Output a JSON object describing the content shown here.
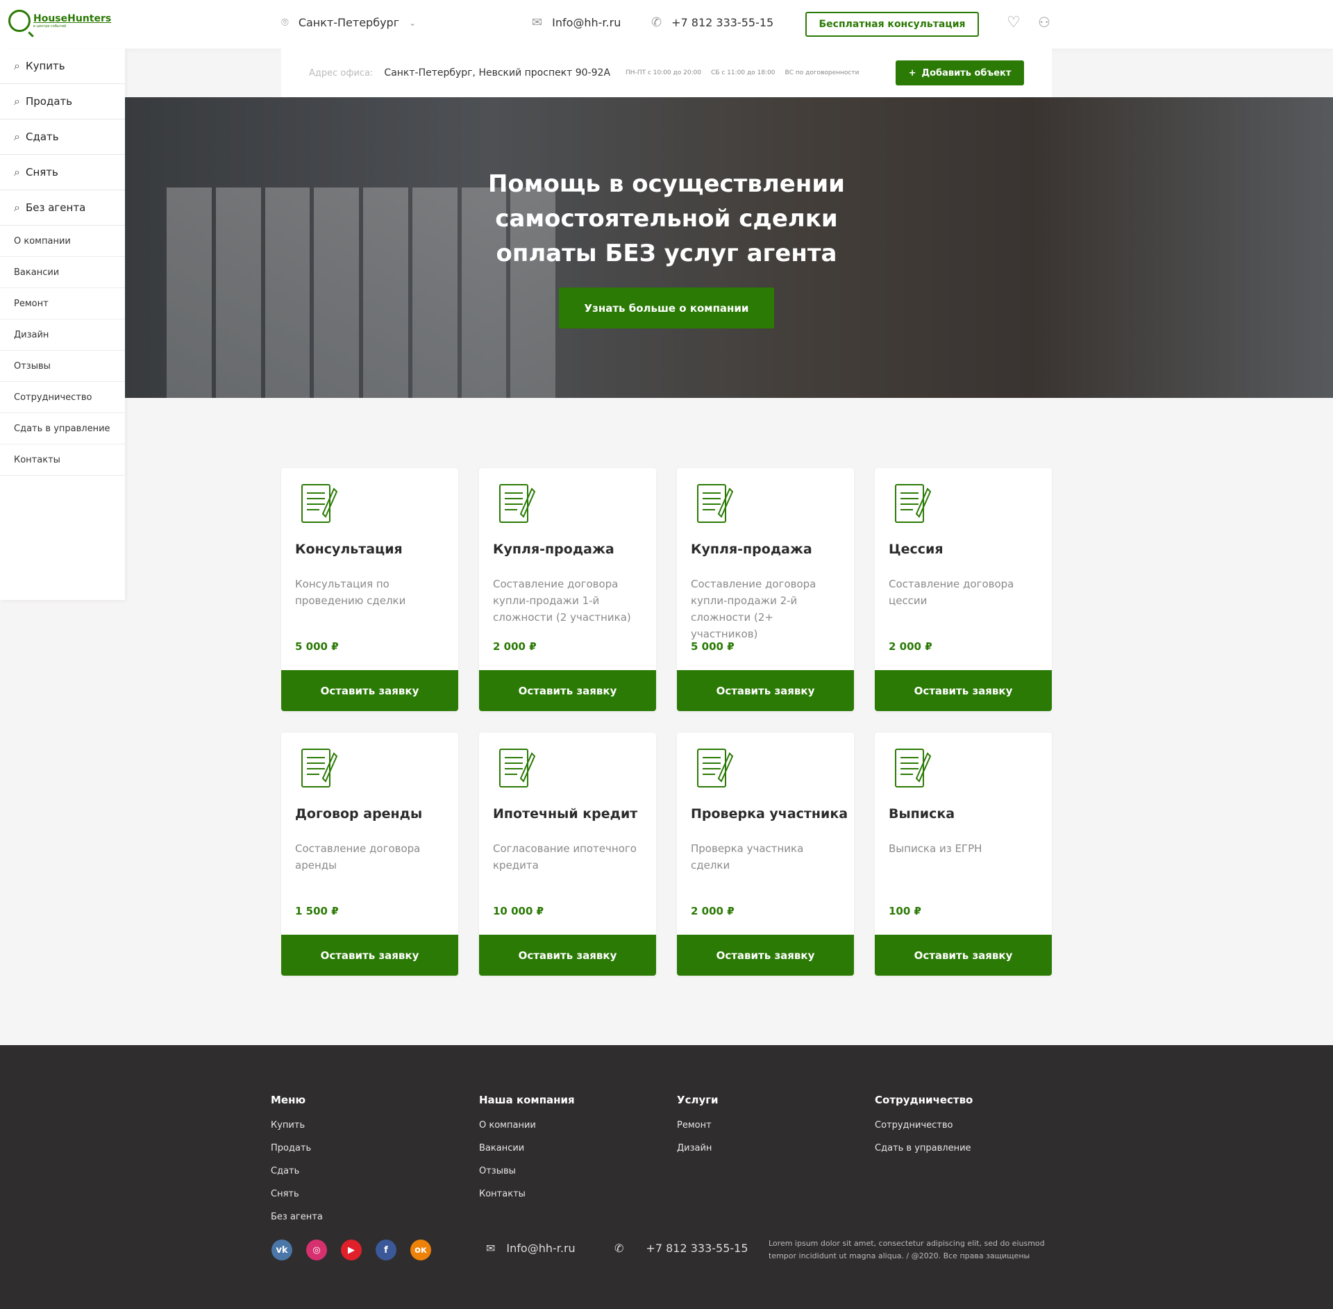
{
  "header": {
    "logo_text": "HouseHunters",
    "logo_sub": "в центре событий",
    "city": "Санкт-Петербург",
    "email": "Info@hh-r.ru",
    "phone": "+7 812 333-55-15",
    "consult_label": "Бесплатная консультация"
  },
  "sidebar": {
    "main": [
      "Купить",
      "Продать",
      "Сдать",
      "Снять",
      "Без агента"
    ],
    "secondary": [
      "О компании",
      "Вакансии",
      "Ремонт",
      "Дизайн",
      "Отзывы",
      "Сотрудничество",
      "Сдать в управление",
      "Контакты"
    ]
  },
  "infobar": {
    "label": "Адрес офиса:",
    "address": "Санкт-Петербург, Невский проспект 90-92А",
    "hours_weekday": "ПН-ПТ с 10:00 до 20:00",
    "hours_sat": "СБ с 11:00 до 18:00",
    "hours_sun": "ВС по договоренности",
    "add_label": "Добавить объект"
  },
  "hero": {
    "title_lines": [
      "Помощь в осуществлении",
      "самостоятельной сделки",
      "оплаты БЕЗ услуг агента"
    ],
    "button": "Узнать больше о компании"
  },
  "cards": [
    {
      "icon": "consultation-icon",
      "title": "Консультация",
      "desc": "Консультация по проведению сделки",
      "price": "5 000 ₽",
      "button": "Оставить заявку"
    },
    {
      "icon": "contract-icon",
      "title": "Купля-продажа",
      "desc": "Составление договора купли-продажи 1-й сложности (2 участника)",
      "price": "2 000 ₽",
      "button": "Оставить заявку"
    },
    {
      "icon": "signed-contract-icon",
      "title": "Купля-продажа",
      "desc": "Составление договора купли-продажи 2-й сложности (2+ участников)",
      "price": "5 000 ₽",
      "button": "Оставить заявку"
    },
    {
      "icon": "document-sign-icon",
      "title": "Цессия",
      "desc": "Составление договора цессии",
      "price": "2 000 ₽",
      "button": "Оставить заявку"
    },
    {
      "icon": "lease-icon",
      "title": "Договор аренды",
      "desc": "Составление договора аренды",
      "price": "1 500 ₽",
      "button": "Оставить заявку"
    },
    {
      "icon": "mortgage-icon",
      "title": "Ипотечный кредит",
      "desc": "Согласование ипотечного кредита",
      "price": "10 000 ₽",
      "button": "Оставить заявку"
    },
    {
      "icon": "participant-check-icon",
      "title": "Проверка участника",
      "desc": "Проверка участника сделки",
      "price": "2 000 ₽",
      "button": "Оставить заявку"
    },
    {
      "icon": "extract-icon",
      "title": "Выписка",
      "desc": "Выписка из ЕГРН",
      "price": "100 ₽",
      "button": "Оставить заявку"
    }
  ],
  "footer": {
    "columns": [
      {
        "title": "Меню",
        "links": [
          "Купить",
          "Продать",
          "Сдать",
          "Снять",
          "Без агента"
        ]
      },
      {
        "title": "Наша компания",
        "links": [
          "О компании",
          "Вакансии",
          "Отзывы",
          "Контакты"
        ]
      },
      {
        "title": "Услуги",
        "links": [
          "Ремонт",
          "Дизайн"
        ]
      },
      {
        "title": "Сотрудничество",
        "links": [
          "Сотрудничество",
          "Сдать в управление"
        ]
      }
    ],
    "email": "Info@hh-r.ru",
    "phone": "+7 812 333-55-15",
    "copyright": "Lorem ipsum dolor sit amet, consectetur adipiscing elit, sed do eiusmod tempor incididunt ut  magna aliqua.  / @2020. Все права защищены",
    "social": [
      {
        "name": "vk",
        "glyph": "vk",
        "color": "#4a76a8"
      },
      {
        "name": "instagram",
        "glyph": "◎",
        "color": "#d6306f"
      },
      {
        "name": "youtube",
        "glyph": "▶",
        "color": "#e0202a"
      },
      {
        "name": "facebook",
        "glyph": "f",
        "color": "#3b5998"
      },
      {
        "name": "odnoklassniki",
        "glyph": "ок",
        "color": "#ee8208"
      }
    ]
  },
  "colors": {
    "accent": "#2b7a05",
    "footer": "#2f2d2e"
  }
}
